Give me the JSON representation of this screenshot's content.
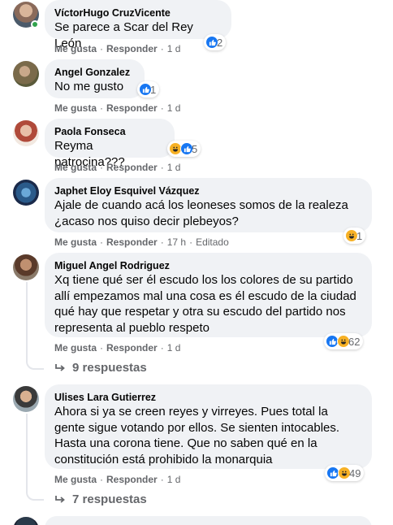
{
  "actions": {
    "like": "Me gusta",
    "reply": "Responder",
    "sep": "·"
  },
  "comments": [
    {
      "author": "VíctorHugo CruzVicente",
      "text": "Se parece a Scar del Rey León",
      "reactions": {
        "icons": [
          "like"
        ],
        "count": "2"
      },
      "time": "1 d",
      "online": true
    },
    {
      "author": "Angel Gonzalez",
      "text": "No me gusto",
      "reactions": {
        "icons": [
          "like"
        ],
        "count": "1"
      },
      "time": "1 d"
    },
    {
      "author": "Paola Fonseca",
      "text": "Reyma patrocina???",
      "reactions": {
        "icons": [
          "haha",
          "like"
        ],
        "count": "5"
      },
      "time": "1 d"
    },
    {
      "author": "Japhet Eloy Esquivel Vázquez",
      "text_lines": [
        "Ajale de cuando acá los leoneses somos de la realeza",
        "¿acaso nos quiso decir plebeyos?"
      ],
      "reactions": {
        "icons": [
          "haha"
        ],
        "count": "1"
      },
      "time": "17 h",
      "edited": "Editado"
    },
    {
      "author": "Miguel Angel Rodriguez",
      "text_lines": [
        "Xq tiene qué ser él escudo los los colores de su partido",
        "allí empezamos mal una cosa es él escudo de la ciudad",
        "qué hay que respetar y otra su escudo del partido nos",
        "representa al pueblo respeto"
      ],
      "reactions": {
        "icons": [
          "like",
          "haha"
        ],
        "count": "62"
      },
      "time": "1 d",
      "replies": "9 respuestas"
    },
    {
      "author": "Ulises Lara Gutierrez",
      "text_lines": [
        "Ahora si ya se creen reyes y virreyes. Pues total la",
        "gente sigue votando por ellos. Se sienten intocables.",
        "Hasta una corona tiene. Que no saben qué en la",
        "constitución está prohibido la monarquia"
      ],
      "reactions": {
        "icons": [
          "like",
          "haha"
        ],
        "count": "49"
      },
      "time": "1 d",
      "replies": "7 respuestas"
    }
  ],
  "colors": {
    "like": "#1877f2",
    "haha": "#f7b125",
    "online": "#31a24c",
    "bubble": "#f0f2f5",
    "meta": "#65676b"
  }
}
